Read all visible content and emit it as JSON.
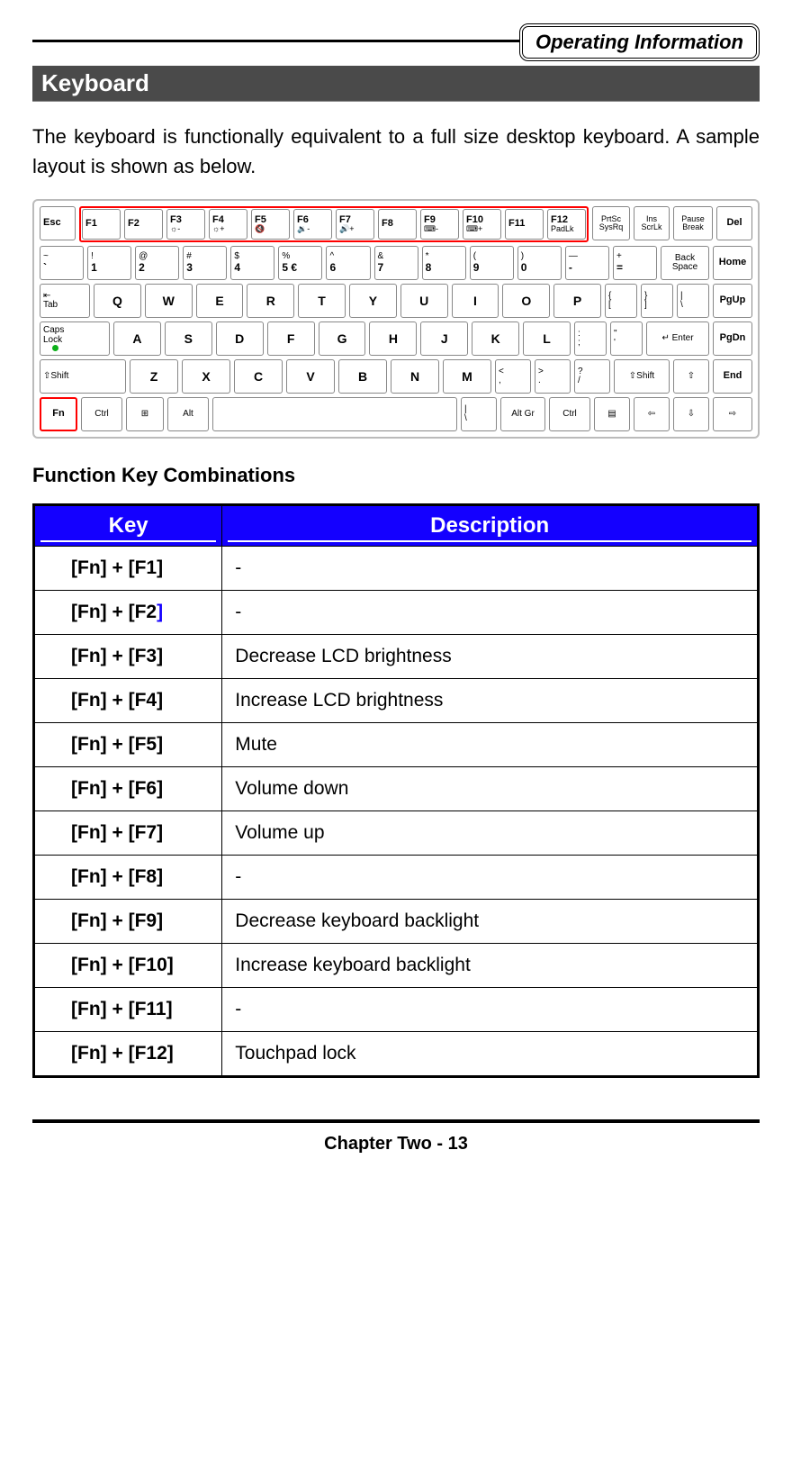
{
  "header": {
    "badge": "Operating Information"
  },
  "section": {
    "title": "Keyboard"
  },
  "intro": "The keyboard is functionally equivalent to a full size desktop keyboard. A sample layout is shown as below.",
  "keyboard": {
    "row0": {
      "esc": "Esc",
      "fkeys": [
        "F1",
        "F2",
        "F3",
        "F4",
        "F5",
        "F6",
        "F7",
        "F8",
        "F9",
        "F10",
        "F11",
        "F12"
      ],
      "fkey_sub": [
        "",
        "",
        "☼-",
        "☼+",
        "🔇",
        "🔉-",
        "🔊+",
        "",
        "⌨-",
        "⌨+",
        "",
        "PadLk"
      ],
      "prtsc": "PrtSc\nSysRq",
      "ins": "Ins\nScrLk",
      "pause": "Pause\nBreak",
      "del": "Del"
    },
    "row1": {
      "k": [
        [
          "~",
          "`"
        ],
        [
          "!",
          "1"
        ],
        [
          "@",
          "2"
        ],
        [
          "#",
          "3"
        ],
        [
          "$",
          "4"
        ],
        [
          "%",
          "5 €"
        ],
        [
          "^",
          "6"
        ],
        [
          "&",
          "7"
        ],
        [
          "*",
          "8"
        ],
        [
          "(",
          "9"
        ],
        [
          ")",
          "0"
        ],
        [
          "—",
          "-"
        ],
        [
          "+",
          "="
        ]
      ],
      "backspace": "Back\nSpace",
      "home": "Home"
    },
    "row2": {
      "tab": "⇤\nTab",
      "letters": [
        "Q",
        "W",
        "E",
        "R",
        "T",
        "Y",
        "U",
        "I",
        "O",
        "P"
      ],
      "brackets": [
        [
          "{",
          "["
        ],
        [
          "}",
          "]"
        ],
        [
          "|",
          "\\"
        ]
      ],
      "pgup": "PgUp"
    },
    "row3": {
      "caps": "Caps\nLock",
      "letters": [
        "A",
        "S",
        "D",
        "F",
        "G",
        "H",
        "J",
        "K",
        "L"
      ],
      "punc": [
        [
          ":",
          ";"
        ],
        [
          "\"",
          "'"
        ]
      ],
      "enter": "↵ Enter",
      "pgdn": "PgDn"
    },
    "row4": {
      "lshift": "⇧Shift",
      "letters": [
        "Z",
        "X",
        "C",
        "V",
        "B",
        "N",
        "M"
      ],
      "punc": [
        [
          "<",
          ","
        ],
        [
          ">",
          "."
        ],
        [
          "?",
          "/"
        ]
      ],
      "rshift": "⇧Shift",
      "up": "⇧",
      "end": "End"
    },
    "row5": {
      "fn": "Fn",
      "ctrl": "Ctrl",
      "win": "⊞",
      "alt": "Alt",
      "space": "",
      "backslash": [
        "|",
        "\\"
      ],
      "altgr": "Alt Gr",
      "rctrl": "Ctrl",
      "menu": "▤",
      "left": "⇦",
      "down": "⇩",
      "right": "⇨"
    }
  },
  "subheading": "Function Key Combinations",
  "table": {
    "headers": [
      "Key",
      "Description"
    ],
    "rows": [
      {
        "key": "[Fn] + [F1]",
        "desc": "-",
        "blue_end": false
      },
      {
        "key": "[Fn] + [F2]",
        "desc": "-",
        "blue_end": true
      },
      {
        "key": "[Fn] + [F3]",
        "desc": "Decrease LCD brightness",
        "blue_end": false
      },
      {
        "key": "[Fn] + [F4]",
        "desc": "Increase LCD brightness",
        "blue_end": false
      },
      {
        "key": "[Fn] + [F5]",
        "desc": "Mute",
        "blue_end": false
      },
      {
        "key": "[Fn] + [F6]",
        "desc": "Volume down",
        "blue_end": false
      },
      {
        "key": "[Fn] + [F7]",
        "desc": "Volume up",
        "blue_end": false
      },
      {
        "key": "[Fn] + [F8]",
        "desc": "-",
        "blue_end": false
      },
      {
        "key": "[Fn] + [F9]",
        "desc": "Decrease keyboard backlight",
        "blue_end": false
      },
      {
        "key": "[Fn] + [F10]",
        "desc": "Increase keyboard backlight",
        "blue_end": false
      },
      {
        "key": "[Fn] + [F11]",
        "desc": "-",
        "blue_end": false
      },
      {
        "key": "[Fn] + [F12]",
        "desc": "Touchpad lock",
        "blue_end": false
      }
    ]
  },
  "footer": "Chapter Two - 13"
}
